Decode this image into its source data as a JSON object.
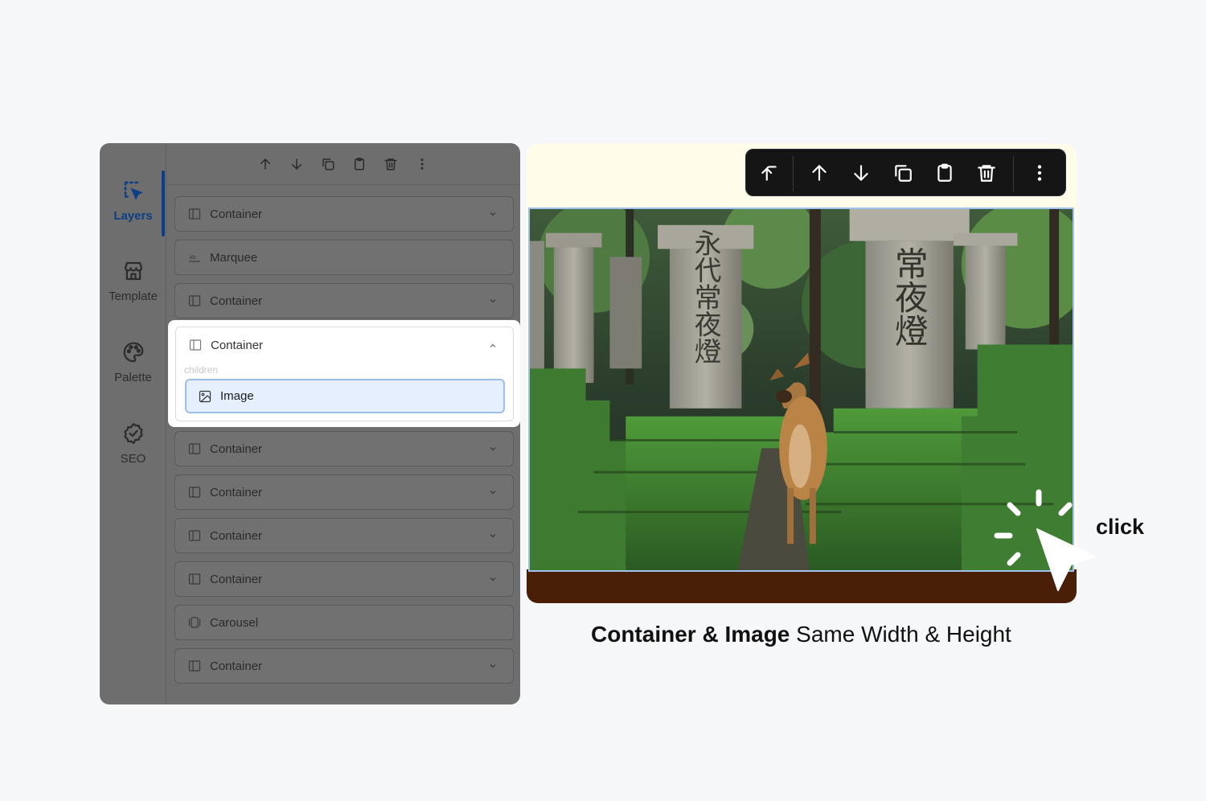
{
  "sidebar": {
    "items": [
      {
        "label": "Layers",
        "icon": "layers-select-icon",
        "active": true
      },
      {
        "label": "Template",
        "icon": "store-icon"
      },
      {
        "label": "Palette",
        "icon": "palette-icon"
      },
      {
        "label": "SEO",
        "icon": "check-badge-icon"
      }
    ]
  },
  "panel_toolbar": {
    "icons": [
      "arrow-up-icon",
      "arrow-down-icon",
      "duplicate-icon",
      "clipboard-icon",
      "trash-icon",
      "more-vertical-icon"
    ]
  },
  "layers": [
    {
      "label": "Container",
      "icon": "columns-icon",
      "chevron": "down"
    },
    {
      "label": "Marquee",
      "icon": "text-ab-icon"
    },
    {
      "label": "Container",
      "icon": "columns-icon",
      "chevron": "down"
    },
    {
      "label": "Container",
      "icon": "columns-icon",
      "chevron": "up",
      "expanded": true,
      "children_label": "children",
      "children": [
        {
          "label": "Image",
          "icon": "image-icon",
          "selected": true
        }
      ]
    },
    {
      "label": "Container",
      "icon": "columns-icon",
      "chevron": "down"
    },
    {
      "label": "Container",
      "icon": "columns-icon",
      "chevron": "down"
    },
    {
      "label": "Container",
      "icon": "columns-icon",
      "chevron": "down"
    },
    {
      "label": "Container",
      "icon": "columns-icon",
      "chevron": "down"
    },
    {
      "label": "Carousel",
      "icon": "carousel-icon"
    },
    {
      "label": "Container",
      "icon": "columns-icon",
      "chevron": "down"
    }
  ],
  "canvas_toolbar": {
    "icons": [
      "select-parent-icon",
      "arrow-up-icon",
      "arrow-down-icon",
      "duplicate-icon",
      "clipboard-icon",
      "trash-icon",
      "more-vertical-icon"
    ]
  },
  "canvas": {
    "top_color": "#fffdea",
    "bottom_color": "#4a1f07",
    "selection_color": "#9fc3ee"
  },
  "annotation": {
    "click_label": "click"
  },
  "caption": {
    "bold": "Container & Image",
    "regular": " Same Width & Height"
  },
  "colors": {
    "accent": "#0b3f86",
    "selected_bg": "#e5effd",
    "selected_border": "#9bbdec"
  }
}
